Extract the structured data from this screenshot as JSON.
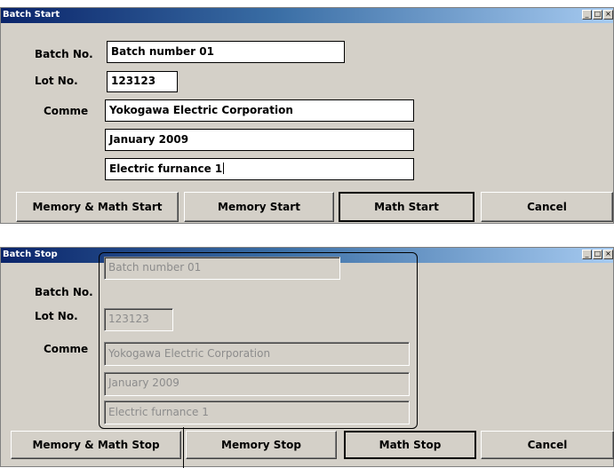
{
  "batch_start": {
    "title": "Batch Start",
    "labels": {
      "batch_no": "Batch No.",
      "lot_no": "Lot No.",
      "comment": "Comme"
    },
    "fields": {
      "batch_no": "Batch number 01",
      "lot_no": "123123",
      "comment1": "Yokogawa Electric Corporation",
      "comment2": "January 2009",
      "comment3": "Electric furnance 1"
    },
    "buttons": {
      "memory_math": "Memory & Math Start",
      "memory": "Memory Start",
      "math": "Math Start",
      "cancel": "Cancel"
    }
  },
  "batch_stop": {
    "title": "Batch Stop",
    "labels": {
      "batch_no": "Batch No.",
      "lot_no": "Lot No.",
      "comment": "Comme"
    },
    "fields": {
      "batch_no": "Batch number 01",
      "lot_no": "123123",
      "comment1": "Yokogawa Electric Corporation",
      "comment2": "January 2009",
      "comment3": "Electric furnance 1"
    },
    "buttons": {
      "memory_math": "Memory & Math Stop",
      "memory": "Memory Stop",
      "math": "Math Stop",
      "cancel": "Cancel"
    }
  },
  "window_controls": {
    "minimize": "_",
    "maximize": "□",
    "close": "×"
  }
}
